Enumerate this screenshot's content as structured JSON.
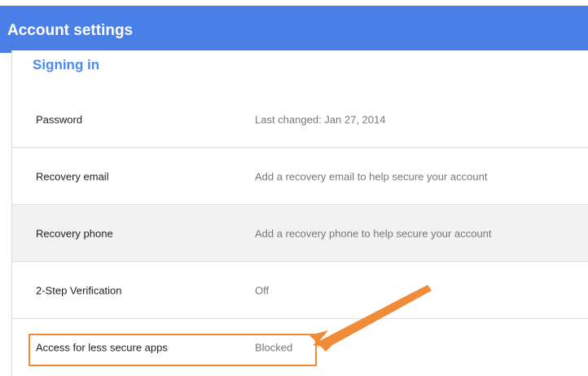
{
  "header": {
    "title": "Account settings",
    "background_color": "#4a7fe8"
  },
  "section": {
    "title": "Signing in"
  },
  "rows": [
    {
      "label": "Password",
      "value": "Last changed: Jan 27, 2014"
    },
    {
      "label": "Recovery email",
      "value": "Add a recovery email to help secure your account"
    },
    {
      "label": "Recovery phone",
      "value": "Add a recovery phone to help secure your account"
    },
    {
      "label": "2-Step Verification",
      "value": "Off"
    },
    {
      "label": "Access for less secure apps",
      "value": "Blocked"
    }
  ],
  "annotation": {
    "highlight_color": "#f08b3a",
    "arrow_icon": "arrow-icon"
  }
}
